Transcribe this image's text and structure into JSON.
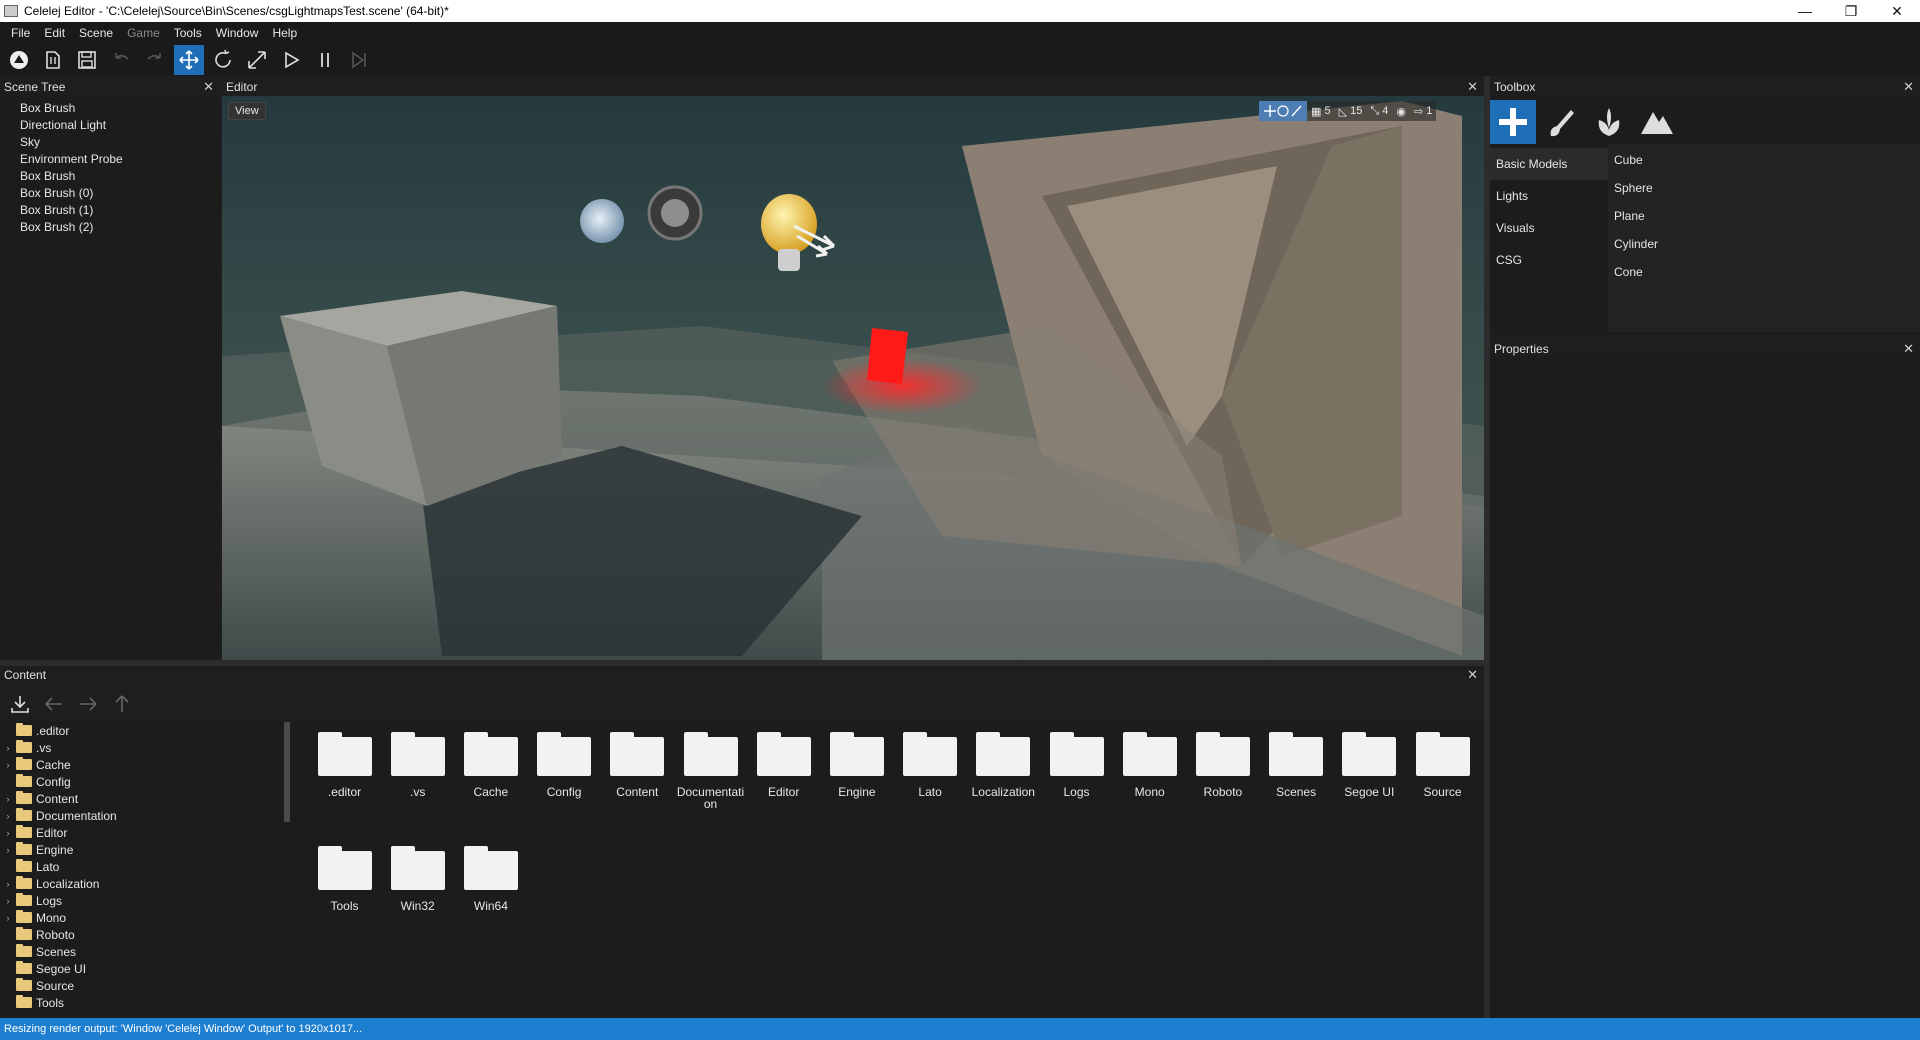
{
  "window": {
    "title": "Celelej Editor - 'C:\\Celelej\\Source\\Bin\\Scenes/csgLightmapsTest.scene' (64-bit)*",
    "minimize": "—",
    "maximize": "❐",
    "close": "✕"
  },
  "menu": [
    "File",
    "Edit",
    "Scene",
    "Game",
    "Tools",
    "Window",
    "Help"
  ],
  "toolbar": {
    "items": [
      "logo-icon",
      "new-icon",
      "save-icon",
      "undo-icon",
      "redo-icon",
      "translate-icon",
      "rotate-icon",
      "scale-icon",
      "play-icon",
      "pause-icon",
      "step-icon"
    ],
    "active": "translate-icon"
  },
  "scene_tree": {
    "title": "Scene Tree",
    "close": "✕",
    "nodes": [
      "Box Brush",
      "Directional Light",
      "Sky",
      "Environment Probe",
      "Box Brush",
      "Box Brush (0)",
      "Box Brush (1)",
      "Box Brush (2)"
    ]
  },
  "editor": {
    "title": "Editor",
    "close": "✕",
    "view_button": "View",
    "viewport_toolbar": {
      "grid_value": "5",
      "angle_value": "15",
      "scale_value": "4",
      "camera_speed": "1"
    }
  },
  "toolbox": {
    "title": "Toolbox",
    "close": "✕",
    "tabs": [
      "add-icon",
      "paint-icon",
      "foliage-icon",
      "terrain-icon"
    ],
    "categories": [
      "Basic Models",
      "Lights",
      "Visuals",
      "CSG"
    ],
    "selected_category": "Basic Models",
    "items": [
      "Cube",
      "Sphere",
      "Plane",
      "Cylinder",
      "Cone"
    ]
  },
  "properties": {
    "title": "Properties",
    "close": "✕"
  },
  "content": {
    "title": "Content",
    "close": "✕",
    "tree": [
      {
        "name": ".editor",
        "expandable": false
      },
      {
        "name": ".vs",
        "expandable": true
      },
      {
        "name": "Cache",
        "expandable": true
      },
      {
        "name": "Config",
        "expandable": false
      },
      {
        "name": "Content",
        "expandable": true
      },
      {
        "name": "Documentation",
        "expandable": true
      },
      {
        "name": "Editor",
        "expandable": true
      },
      {
        "name": "Engine",
        "expandable": true
      },
      {
        "name": "Lato",
        "expandable": false
      },
      {
        "name": "Localization",
        "expandable": true
      },
      {
        "name": "Logs",
        "expandable": true
      },
      {
        "name": "Mono",
        "expandable": true
      },
      {
        "name": "Roboto",
        "expandable": false
      },
      {
        "name": "Scenes",
        "expandable": false
      },
      {
        "name": "Segoe UI",
        "expandable": false
      },
      {
        "name": "Source",
        "expandable": false
      },
      {
        "name": "Tools",
        "expandable": false
      }
    ],
    "folders": [
      ".editor",
      ".vs",
      "Cache",
      "Config",
      "Content",
      "Documentati on",
      "Editor",
      "Engine",
      "Lato",
      "Localization",
      "Logs",
      "Mono",
      "Roboto",
      "Scenes",
      "Segoe UI",
      "Source",
      "Tools",
      "Win32",
      "Win64"
    ]
  },
  "status": {
    "text": "Resizing render output: 'Window 'Celelej Window' Output' to 1920x1017..."
  },
  "colors": {
    "accent": "#1e6fb8",
    "status_bar": "#1e7fd0",
    "panel_bg": "#1c1c1c"
  }
}
